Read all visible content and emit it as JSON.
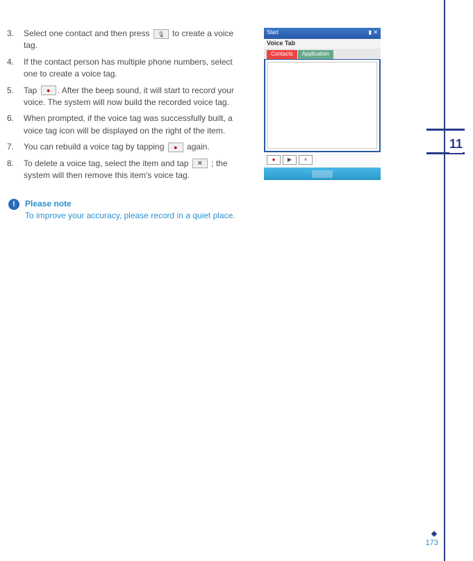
{
  "chapter": "11",
  "steps": [
    {
      "num": "3.",
      "pre": "Select one contact and then press ",
      "icon": "mic",
      "post": " to create a voice tag."
    },
    {
      "num": "4.",
      "text": "If the contact person has multiple phone numbers, select one to create a voice tag."
    },
    {
      "num": "5.",
      "pre": "Tap ",
      "icon": "record",
      "post": ". After the beep sound, it will start to record your voice. The system will now build the recorded voice tag."
    },
    {
      "num": "6.",
      "text": "When prompted, if the voice tag was successfully built, a voice tag icon will be displayed on the right of the item."
    },
    {
      "num": "7.",
      "pre": "You can rebuild a voice tag by tapping ",
      "icon": "record",
      "post": " again."
    },
    {
      "num": "8.",
      "pre": "To delete a voice tag, select the item and tap ",
      "icon": "delete",
      "post": " ; the system will then remove this item's voice tag."
    }
  ],
  "note": {
    "title": "Please note",
    "body": "To improve your accuracy, please record in a quiet place."
  },
  "phone": {
    "status_left": "Start",
    "title": "Voice Tab",
    "tab1": "Contacts",
    "tab2": "Application"
  },
  "page_number": "173"
}
